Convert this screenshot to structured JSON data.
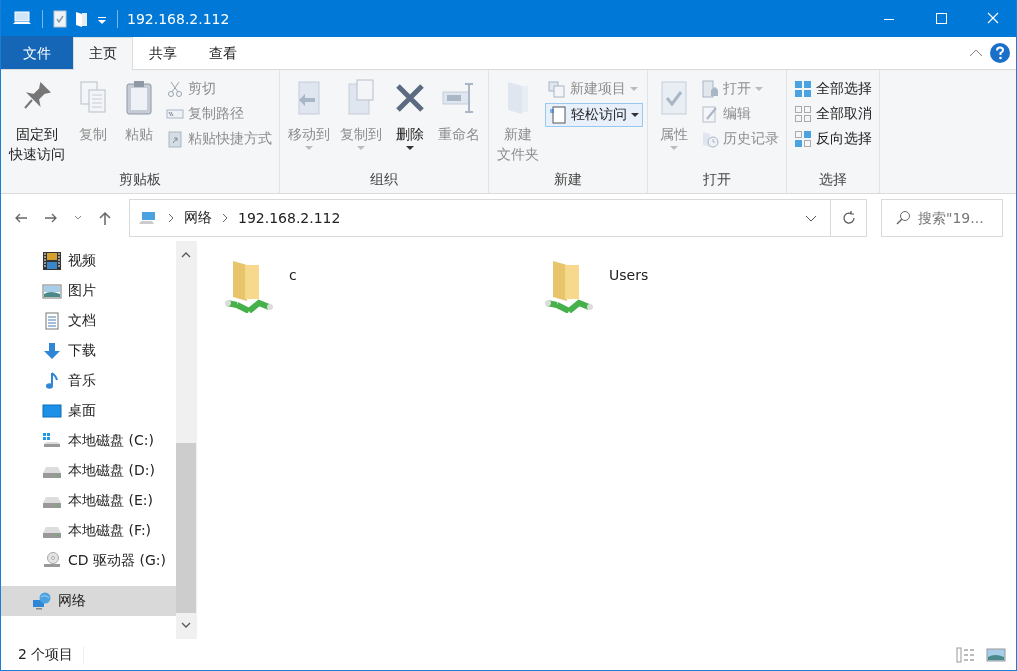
{
  "window": {
    "title": "192.168.2.112"
  },
  "tabs": [
    {
      "label": "文件",
      "kind": "file",
      "selected": false
    },
    {
      "label": "主页",
      "kind": "tab",
      "selected": true
    },
    {
      "label": "共享",
      "kind": "tab",
      "selected": false
    },
    {
      "label": "查看",
      "kind": "tab",
      "selected": false
    }
  ],
  "ribbon": {
    "groups": [
      {
        "label": "剪贴板",
        "items": [
          {
            "kind": "large",
            "lines": [
              "固定到",
              "快速访问"
            ],
            "disabled": false,
            "dropdown": false
          },
          {
            "kind": "large",
            "lines": [
              "复制"
            ],
            "disabled": true,
            "dropdown": false
          },
          {
            "kind": "large",
            "lines": [
              "粘贴"
            ],
            "disabled": true,
            "dropdown": false
          },
          {
            "kind": "small",
            "lines": [
              "剪切"
            ],
            "disabled": true,
            "dropdown": false
          },
          {
            "kind": "small",
            "lines": [
              "复制路径"
            ],
            "disabled": true,
            "dropdown": false
          },
          {
            "kind": "small",
            "lines": [
              "粘贴快捷方式"
            ],
            "disabled": true,
            "dropdown": false
          }
        ]
      },
      {
        "label": "组织",
        "items": [
          {
            "kind": "large",
            "lines": [
              "移动到"
            ],
            "disabled": true,
            "dropdown": true
          },
          {
            "kind": "large",
            "lines": [
              "复制到"
            ],
            "disabled": true,
            "dropdown": true
          },
          {
            "kind": "large",
            "lines": [
              "删除"
            ],
            "disabled": false,
            "dropdown": true
          },
          {
            "kind": "large",
            "lines": [
              "重命名"
            ],
            "disabled": true,
            "dropdown": false
          }
        ]
      },
      {
        "label": "新建",
        "items": [
          {
            "kind": "large",
            "lines": [
              "新建",
              "文件夹"
            ],
            "disabled": true,
            "dropdown": false
          },
          {
            "kind": "small",
            "lines": [
              "新建项目"
            ],
            "disabled": true,
            "dropdown": true
          },
          {
            "kind": "boxed",
            "lines": [
              "轻松访问"
            ],
            "disabled": false,
            "dropdown": true
          }
        ]
      },
      {
        "label": "打开",
        "items": [
          {
            "kind": "large",
            "lines": [
              "属性"
            ],
            "disabled": true,
            "dropdown": true
          },
          {
            "kind": "small",
            "lines": [
              "打开"
            ],
            "disabled": true,
            "dropdown": true
          },
          {
            "kind": "small",
            "lines": [
              "编辑"
            ],
            "disabled": true,
            "dropdown": false
          },
          {
            "kind": "small",
            "lines": [
              "历史记录"
            ],
            "disabled": true,
            "dropdown": false
          }
        ]
      },
      {
        "label": "选择",
        "items": [
          {
            "kind": "small",
            "lines": [
              "全部选择"
            ],
            "disabled": false,
            "dropdown": false
          },
          {
            "kind": "small",
            "lines": [
              "全部取消"
            ],
            "disabled": false,
            "dropdown": false
          },
          {
            "kind": "small",
            "lines": [
              "反向选择"
            ],
            "disabled": false,
            "dropdown": false
          }
        ]
      }
    ]
  },
  "address": {
    "crumbs": [
      "网络",
      "192.168.2.112"
    ],
    "search": {
      "placeholder": "搜索\"19..."
    }
  },
  "nav": {
    "this_pc_children": [
      {
        "label": "视频",
        "selected": false
      },
      {
        "label": "图片",
        "selected": false
      },
      {
        "label": "文档",
        "selected": false
      },
      {
        "label": "下载",
        "selected": false
      },
      {
        "label": "音乐",
        "selected": false
      },
      {
        "label": "桌面",
        "selected": false
      },
      {
        "label": "本地磁盘 (C:)",
        "selected": false
      },
      {
        "label": "本地磁盘 (D:)",
        "selected": false
      },
      {
        "label": "本地磁盘 (E:)",
        "selected": false
      },
      {
        "label": "本地磁盘 (F:)",
        "selected": false
      },
      {
        "label": "CD 驱动器 (G:)",
        "selected": false
      }
    ],
    "roots": [
      {
        "label": "网络",
        "selected": true
      }
    ]
  },
  "files": [
    {
      "name": "c"
    },
    {
      "name": "Users"
    }
  ],
  "status_bar": {
    "count": "2 个项目"
  }
}
